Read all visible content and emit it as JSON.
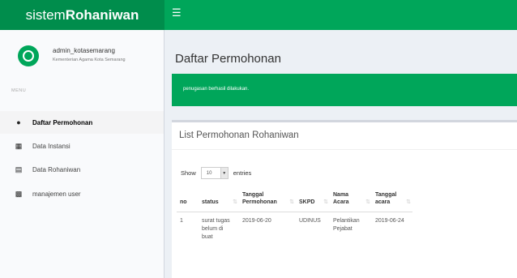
{
  "brand": {
    "light": "sistem",
    "bold": "Rohaniwan"
  },
  "header": {
    "menu_icon": "hamburger-icon"
  },
  "user": {
    "name": "admin_kotasemarang",
    "org": "Kementerian Agama Kota Semarang"
  },
  "sidebar": {
    "header": "MENU",
    "items": [
      {
        "label": "Daftar Permohonan",
        "icon": "circle-icon",
        "active": true
      },
      {
        "label": "Data Instansi",
        "icon": "bank-icon",
        "active": false
      },
      {
        "label": "Data Rohaniwan",
        "icon": "list-icon",
        "active": false
      },
      {
        "label": "manajemen user",
        "icon": "users-icon",
        "active": false
      }
    ]
  },
  "page": {
    "title": "Daftar Permohonan",
    "alert": "penugasan berhasil dilakukan."
  },
  "box": {
    "title": "List Permohonan Rohaniwan",
    "length": {
      "show": "Show",
      "value": "10",
      "entries": "entries"
    }
  },
  "table": {
    "headers": {
      "no": "no",
      "status": "status",
      "tanggal_permohonan_1": "Tanggal",
      "tanggal_permohonan_2": "Permohonan",
      "skpd": "SKPD",
      "nama_acara_1": "Nama",
      "nama_acara_2": "Acara",
      "tanggal_acara_1": "Tanggal",
      "tanggal_acara_2": "acara"
    },
    "rows": [
      {
        "no": "1",
        "status": "surat tugas belum di buat",
        "tanggal_permohonan": "2019-06-20",
        "skpd": "UDINUS",
        "nama_acara": "Pelantikan Pejabat",
        "tanggal_acara": "2019-06-24"
      }
    ]
  },
  "colors": {
    "primary": "#00a65a",
    "brand_dark": "#008d4c"
  }
}
